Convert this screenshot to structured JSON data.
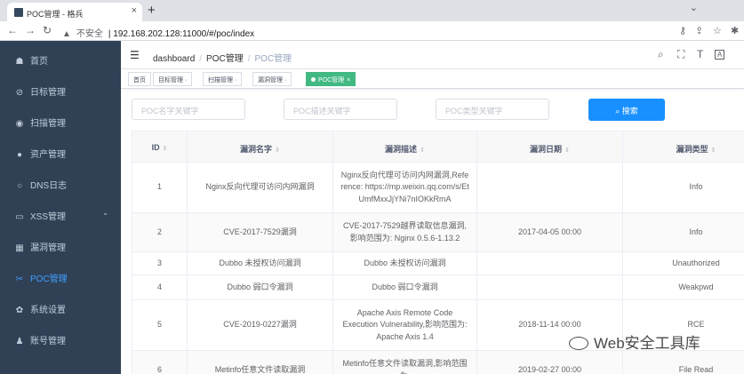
{
  "browser": {
    "tab_title": "POC管理 - 格兵",
    "url": "192.168.202.128:11000/#/poc/index",
    "insecure_label": "不安全"
  },
  "sidebar": {
    "items": [
      {
        "label": "首页",
        "icon": "dashboard-icon"
      },
      {
        "label": "日标管理",
        "icon": "link-icon"
      },
      {
        "label": "扫描管理",
        "icon": "eye-icon"
      },
      {
        "label": "资产管理",
        "icon": "info-icon"
      },
      {
        "label": "DNS日志",
        "icon": "chat-icon"
      },
      {
        "label": "XSS管理",
        "icon": "monitor-icon"
      },
      {
        "label": "漏洞管理",
        "icon": "grid-icon"
      },
      {
        "label": "POC管理",
        "icon": "scissors-icon",
        "active": true
      },
      {
        "label": "系统设置",
        "icon": "gear-icon"
      },
      {
        "label": "账号管理",
        "icon": "user-icon"
      }
    ]
  },
  "breadcrumb": [
    "dashboard",
    "POC管理",
    "POC管理"
  ],
  "tags": [
    "首页",
    "目标管理 ·",
    "扫描管理 ·",
    "漏洞管理 ·",
    "POC管理"
  ],
  "filters": {
    "name_placeholder": "POC名字关键字",
    "desc_placeholder": "POC描述关键字",
    "type_placeholder": "POC类型关键字",
    "search_label": "搜索"
  },
  "table": {
    "headers": [
      "ID",
      "漏洞名字",
      "漏洞描述",
      "漏洞日期",
      "漏洞类型"
    ],
    "rows": [
      {
        "id": "1",
        "name": "Nginx反向代理可访问内网漏洞",
        "desc": "Nginx反向代理可访问内网漏洞,Reference: https://mp.weixin.qq.com/s/EtUmfMxxJjYNi7nIOKkRmA",
        "date": "",
        "type": "Info"
      },
      {
        "id": "2",
        "name": "CVE-2017-7529漏洞",
        "desc": "CVE-2017-7529越界读取信息漏洞,影响范围为: Nginx 0.5.6-1.13.2",
        "date": "2017-04-05 00:00",
        "type": "Info"
      },
      {
        "id": "3",
        "name": "Dubbo 未授权访问漏洞",
        "desc": "Dubbo 未授权访问漏洞",
        "date": "",
        "type": "Unauthorized"
      },
      {
        "id": "4",
        "name": "Dubbo 弱口令漏洞",
        "desc": "Dubbo 弱口令漏洞",
        "date": "",
        "type": "Weakpwd"
      },
      {
        "id": "5",
        "name": "CVE-2019-0227漏洞",
        "desc": "Apache Axis Remote Code Execution Vulnerability,影响范围为: Apache Axis 1.4",
        "date": "2018-11-14 00:00",
        "type": "RCE"
      },
      {
        "id": "6",
        "name": "Metinfo任意文件读取漏洞",
        "desc": "Metinfo任意文件读取漏洞,影响范围为:",
        "date": "2019-02-27 00:00",
        "type": "File Read"
      }
    ]
  },
  "watermark": "Web安全工具库"
}
